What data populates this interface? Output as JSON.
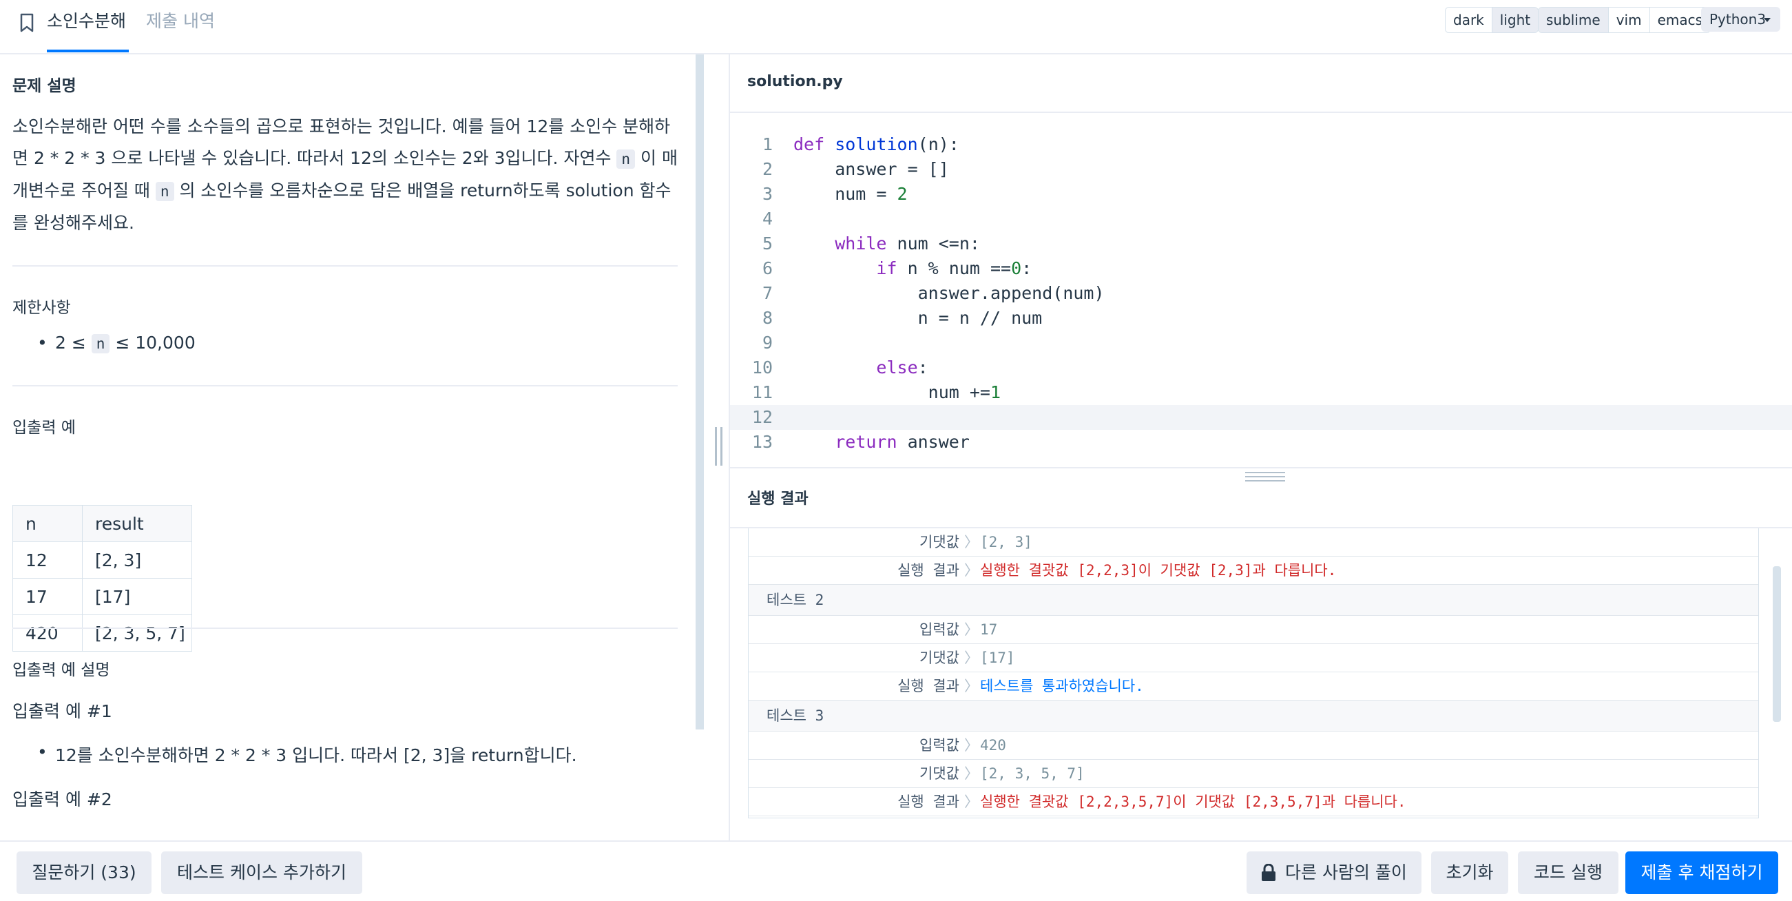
{
  "header": {
    "tabs": [
      {
        "label": "소인수분해",
        "active": true
      },
      {
        "label": "제출 내역",
        "active": false
      }
    ],
    "theme_options": [
      "dark",
      "light"
    ],
    "theme_selected": "light",
    "keymap_options": [
      "sublime",
      "vim",
      "emacs"
    ],
    "keymap_selected": "sublime",
    "language": "Python3"
  },
  "problem": {
    "description_heading": "문제 설명",
    "description": {
      "p1": "소인수분해란 어떤 수를 소수들의 곱으로 표현하는 것입니다. 예를 들어 12를 소인수 분해하",
      "p2a": "면 2 * 2 * 3 으로 나타낼 수 있습니다. 따라서 12의 소인수는 2와 3입니다. 자연수 ",
      "code_n": "n",
      "p2b": " 이 매",
      "p3a": "개변수로 주어질 때 ",
      "p3b": " 의 소인수를 오름차순으로 담은 배열을 return하도록 solution 함수",
      "p4": "를 완성해주세요."
    },
    "constraints_heading": "제한사항",
    "constraint": {
      "pre": "2 ≤ ",
      "var": "n",
      "post": " ≤ 10,000"
    },
    "io_heading": "입출력 예",
    "io_table": {
      "headers": [
        "n",
        "result"
      ],
      "rows": [
        [
          "12",
          "[2, 3]"
        ],
        [
          "17",
          "[17]"
        ],
        [
          "420",
          "[2, 3, 5, 7]"
        ]
      ]
    },
    "io_explain_heading": "입출력 예 설명",
    "example1_heading": "입출력 예 #1",
    "example1_bullet": "12를 소인수분해하면 2 * 2 * 3 입니다. 따라서 [2, 3]을 return합니다.",
    "example2_heading": "입출력 예 #2"
  },
  "editor": {
    "filename": "solution.py",
    "lines": [
      "def solution(n):",
      "    answer = []",
      "    num = 2",
      "",
      "    while num <=n:",
      "        if n % num ==0:",
      "            answer.append(num)",
      "            n = n // num",
      "",
      "        else:",
      "             num +=1",
      "",
      "    return answer"
    ],
    "current_line": 12
  },
  "results": {
    "title": "실행 결과",
    "rows": [
      {
        "kind": "kv",
        "label": "기댓값",
        "value": "[2, 3]",
        "status": "normal"
      },
      {
        "kind": "kv",
        "label": "실행 결과",
        "value": "실행한 결괏값 [2,2,3]이 기댓값 [2,3]과 다릅니다.",
        "status": "fail"
      },
      {
        "kind": "test",
        "label": "테스트 2"
      },
      {
        "kind": "kv",
        "label": "입력값",
        "value": "17",
        "status": "normal"
      },
      {
        "kind": "kv",
        "label": "기댓값",
        "value": "[17]",
        "status": "normal"
      },
      {
        "kind": "kv",
        "label": "실행 결과",
        "value": "테스트를 통과하였습니다.",
        "status": "pass"
      },
      {
        "kind": "test",
        "label": "테스트 3"
      },
      {
        "kind": "kv",
        "label": "입력값",
        "value": "420",
        "status": "normal"
      },
      {
        "kind": "kv",
        "label": "기댓값",
        "value": "[2, 3, 5, 7]",
        "status": "normal"
      },
      {
        "kind": "kv",
        "label": "실행 결과",
        "value": "실행한 결괏값 [2,2,3,5,7]이 기댓값 [2,3,5,7]과 다릅니다.",
        "status": "fail"
      }
    ]
  },
  "footer": {
    "ask_button": "질문하기 (33)",
    "add_testcase_button": "테스트 케이스 추가하기",
    "others_solution_button": "다른 사람의 풀이",
    "reset_button": "초기화",
    "run_button": "코드 실행",
    "submit_button": "제출 후 채점하기"
  },
  "colors": {
    "accent": "#0078ff",
    "fail": "#d12a2a",
    "keyword": "#8b2bbf",
    "function": "#0037d6",
    "number": "#1a7f37"
  }
}
